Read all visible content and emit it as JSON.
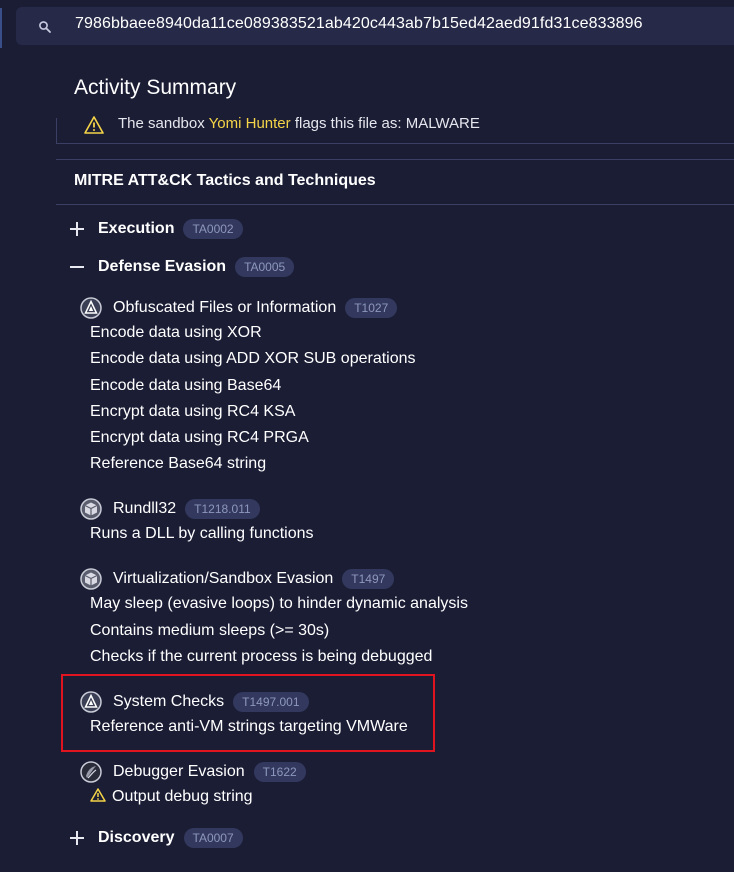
{
  "search": {
    "value": "7986bbaee8940da11ce089383521ab420c443ab7b15ed42aed91fd31ce833896"
  },
  "panel": {
    "title": "Activity Summary",
    "sandbox": {
      "prefix": "The sandbox",
      "name": "Yomi Hunter",
      "suffix": "flags this file as: MALWARE"
    },
    "section_title": "MITRE ATT&CK Tactics and Techniques"
  },
  "tactics": [
    {
      "name": "Execution",
      "id": "TA0002",
      "expanded": false
    },
    {
      "name": "Defense Evasion",
      "id": "TA0005",
      "expanded": true,
      "techniques": [
        {
          "name": "Obfuscated Files or Information",
          "id": "T1027",
          "icon": "malware-triangle-icon",
          "behaviors": [
            "Encode data using XOR",
            "Encode data using ADD XOR SUB operations",
            "Encode data using Base64",
            "Encrypt data using RC4 KSA",
            "Encrypt data using RC4 PRGA",
            "Reference Base64 string"
          ]
        },
        {
          "name": "Rundll32",
          "id": "T1218.011",
          "icon": "box-icon",
          "behaviors": [
            "Runs a DLL by calling functions"
          ]
        },
        {
          "name": "Virtualization/Sandbox Evasion",
          "id": "T1497",
          "icon": "box-icon",
          "behaviors": [
            "May sleep (evasive loops) to hinder dynamic analysis",
            "Contains medium sleeps (>= 30s)",
            "Checks if the current process is being debugged"
          ]
        },
        {
          "name": "System Checks",
          "id": "T1497.001",
          "icon": "malware-triangle-icon",
          "behaviors": [
            "Reference anti-VM strings targeting VMWare"
          ]
        },
        {
          "name": "Debugger Evasion",
          "id": "T1622",
          "icon": "swirl-icon",
          "behaviors": [
            "Output debug string"
          ]
        }
      ]
    },
    {
      "name": "Discovery",
      "id": "TA0007",
      "expanded": false
    }
  ],
  "colors": {
    "background": "#1b1d35",
    "badge_bg": "#33395e",
    "badge_text": "#8e97bd",
    "highlight": "#e0141e",
    "warning": "#f5d547"
  }
}
